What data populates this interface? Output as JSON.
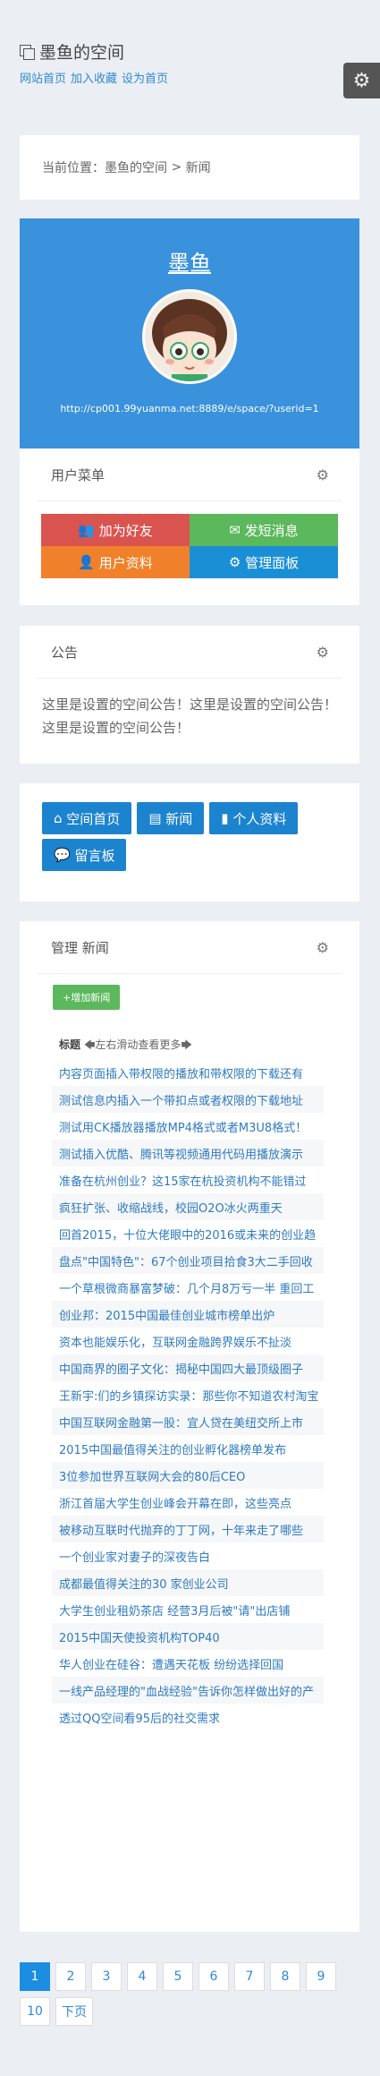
{
  "site": {
    "title": "墨鱼的空间",
    "links": [
      "网站首页",
      "加入收藏",
      "设为首页"
    ]
  },
  "breadcrumb": {
    "prefix": "当前位置：",
    "home": "墨鱼的空间",
    "sep": " > ",
    "current": "新闻"
  },
  "profile": {
    "name": "墨鱼",
    "url": "http://cp001.99yuanma.net:8889/e/space/?userid=1"
  },
  "user_menu": {
    "title": "用户菜单",
    "buttons": [
      "加为好友",
      "发短消息",
      "用户资料",
      "管理面板"
    ],
    "colors": [
      "#d9534f",
      "#5cb85c",
      "#f0812a",
      "#1b8fd6"
    ]
  },
  "notice": {
    "title": "公告",
    "text": "这里是设置的空间公告！这里是设置的空间公告！这里是设置的空间公告！"
  },
  "space_nav": {
    "buttons": [
      "空间首页",
      "新闻",
      "个人资料",
      "留言板"
    ]
  },
  "manage": {
    "title": "管理 新闻",
    "add_label": "+增加新闻",
    "col_header": "标题",
    "scroll_hint": "左右滑动查看更多",
    "rows": [
      "内容页面插入带权限的播放和带权限的下载还有",
      "测试信息内插入一个带扣点或者权限的下载地址",
      "测试用CK播放器播放MP4格式或者M3U8格式！",
      "测试插入优酷、腾讯等视频通用代码用播放演示",
      "准备在杭州创业？这15家在杭投资机构不能错过",
      "疯狂扩张、收缩战线，校园O2O冰火两重天",
      "回首2015，十位大佬眼中的2016或未来的创业趋",
      "盘点\"中国特色\"：67个创业项目拾食3大二手回收",
      "一个草根微商暴富梦破：几个月8万亏一半 重回工",
      "创业邦：2015中国最佳创业城市榜单出炉",
      "资本也能娱乐化，互联网金融跨界娱乐不扯淡",
      "中国商界的圈子文化：揭秘中国四大最顶级圈子",
      "王新宇:们的乡镇探访实录：那些你不知道农村淘宝",
      "中国互联网金融第一股：宜人贷在美纽交所上市",
      "2015中国最值得关注的创业孵化器榜单发布",
      "3位参加世界互联网大会的80后CEO",
      "浙江首届大学生创业峰会开幕在即，这些亮点",
      "被移动互联时代抛弃的丁丁网，十年来走了哪些",
      "一个创业家对妻子的深夜告白",
      "成都最值得关注的30 家创业公司",
      "大学生创业租奶茶店 经营3月后被\"请\"出店铺",
      "2015中国天使投资机构TOP40",
      "华人创业在硅谷：遭遇天花板 纷纷选择回国",
      "一线产品经理的\"血战经验\"告诉你怎样做出好的产",
      "透过QQ空间看95后的社交需求"
    ]
  },
  "pagination": {
    "pages": [
      "1",
      "2",
      "3",
      "4",
      "5",
      "6",
      "7",
      "8",
      "9",
      "10"
    ],
    "next": "下页",
    "current": "1"
  }
}
